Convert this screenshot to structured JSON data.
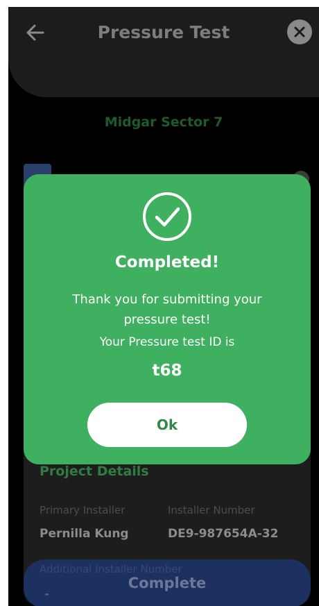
{
  "header": {
    "title": "Pressure Test"
  },
  "site": {
    "name": "Midgar Sector 7"
  },
  "modal": {
    "heading": "Completed!",
    "message": "Thank you for submitting your pressure test!",
    "id_label": "Your Pressure test ID is",
    "id_value": "t68",
    "ok_label": "Ok"
  },
  "project": {
    "title": "Project Details",
    "primary_installer_label": "Primary Installer",
    "primary_installer_value": "Pernilla Kung",
    "installer_number_label": "Installer Number",
    "installer_number_value": "DE9-987654A-32",
    "additional_installer_label": "Additional Installer Number",
    "additional_installer_value": "-"
  },
  "footer": {
    "complete_label": "Complete"
  },
  "icons": [
    "back-arrow-icon",
    "close-icon",
    "check-circle-icon",
    "clipboard-icon"
  ],
  "colors": {
    "modal_bg": "#3fb05f",
    "accent_green": "#2f8a48",
    "complete_bg": "#1e346a"
  }
}
